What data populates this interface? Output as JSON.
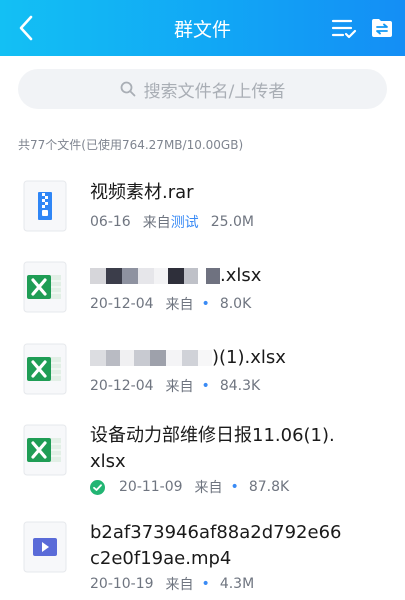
{
  "header": {
    "title": "群文件"
  },
  "search": {
    "placeholder": "搜索文件名/上传者"
  },
  "summary": "共77个文件(已使用764.27MB/10.00GB)",
  "files": [
    {
      "name": "视频素材.rar",
      "date": "06-16",
      "from_label": "来自",
      "sender": "测试",
      "size": "25.0M",
      "icon": "archive-icon"
    },
    {
      "name_visible": ".xlsx",
      "date": "20-12-04",
      "from_label": "来自",
      "size": "8.0K",
      "icon": "excel-icon"
    },
    {
      "name_visible": ")(1).xlsx",
      "date": "20-12-04",
      "from_label": "来自",
      "size": "84.3K",
      "icon": "excel-icon"
    },
    {
      "name_line1": "设备动力部维修日报11.06(1).",
      "name_line2": "xlsx",
      "date": "20-11-09",
      "from_label": "来自",
      "size": "87.8K",
      "icon": "excel-icon",
      "downloaded": true
    },
    {
      "name_line1": "b2af373946af88a2d792e66",
      "name_line2": "c2e0f19ae.mp4",
      "date": "20-10-19",
      "from_label": "来自",
      "size": "4.3M",
      "icon": "video-icon"
    }
  ],
  "colors": {
    "header_start": "#13c0f4",
    "header_end": "#148ef5",
    "accent": "#3a8bf5",
    "excel_green": "#1f9d55"
  }
}
